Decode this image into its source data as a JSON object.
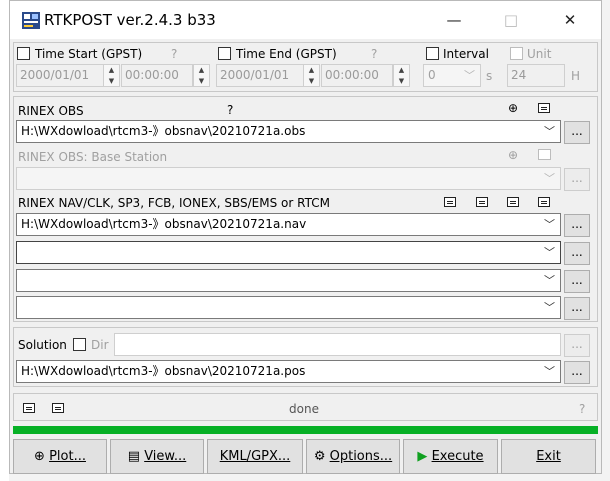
{
  "window": {
    "title": "RTKPOST ver.2.4.3 b33",
    "controls": {
      "minimize": "—",
      "maximize": "□",
      "close": "✕"
    }
  },
  "time_section": {
    "time_start": {
      "label": "Time Start (GPST)",
      "help": "?",
      "date": "2000/01/01",
      "time": "00:00:00"
    },
    "time_end": {
      "label": "Time End (GPST)",
      "help": "?",
      "date": "2000/01/01",
      "time": "00:00:00"
    },
    "interval": {
      "label": "Interval",
      "value": "0",
      "unit": "s"
    },
    "unit": {
      "label": "Unit",
      "value": "24",
      "unit": "H"
    }
  },
  "inputs": {
    "rinex_obs": {
      "label": "RINEX OBS",
      "help": "?",
      "value": "H:\\WXdowload\\rtcm3-》obsnav\\20210721a.obs"
    },
    "base_station": {
      "label": "RINEX OBS: Base Station",
      "value": ""
    },
    "nav_header": {
      "label": "RINEX NAV/CLK, SP3, FCB, IONEX, SBS/EMS  or RTCM"
    },
    "nav_files": [
      "H:\\WXdowload\\rtcm3-》obsnav\\20210721a.nav",
      "",
      "",
      ""
    ],
    "browse_label": "..."
  },
  "solution": {
    "label": "Solution",
    "dir_label": "Dir",
    "dir_value": "",
    "output": "H:\\WXdowload\\rtcm3-》obsnav\\20210721a.pos"
  },
  "status": {
    "text": "done",
    "help": "?",
    "progress": 1.0,
    "progress_color": "#06b025"
  },
  "buttons": {
    "plot": "Plot...",
    "view": "View...",
    "kml": "KML/GPX...",
    "options": "Options...",
    "execute": "Execute",
    "exit": "Exit"
  },
  "icons": {
    "app": "app-icon",
    "satellite": "satellite-icon",
    "document": "document-icon",
    "gear": "gear-icon",
    "play": "play-icon"
  }
}
